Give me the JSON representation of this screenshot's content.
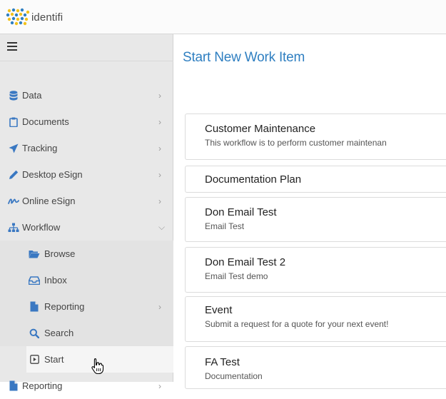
{
  "app": {
    "logo_text": "identifi"
  },
  "colors": {
    "accent": "#2f7fc1",
    "sidebar_bg": "#e8e8e8",
    "icon": "#3a78c2"
  },
  "sidebar": {
    "menu_icon": "hamburger-icon",
    "items": [
      {
        "label": "Data",
        "icon": "database-icon",
        "chevron": ">"
      },
      {
        "label": "Documents",
        "icon": "clipboard-icon",
        "chevron": ">"
      },
      {
        "label": "Tracking",
        "icon": "send-icon",
        "chevron": ">"
      },
      {
        "label": "Desktop eSign",
        "icon": "pen-icon",
        "chevron": ">"
      },
      {
        "label": "Online eSign",
        "icon": "signature-icon",
        "chevron": ">"
      },
      {
        "label": "Workflow",
        "icon": "sitemap-icon",
        "chevron": "v"
      },
      {
        "label": "Browse",
        "icon": "folder-open-icon"
      },
      {
        "label": "Inbox",
        "icon": "inbox-icon"
      },
      {
        "label": "Reporting",
        "icon": "file-icon",
        "chevron": ">"
      },
      {
        "label": "Search",
        "icon": "search-icon"
      },
      {
        "label": "Start",
        "icon": "play-square-icon"
      },
      {
        "label": "Reporting",
        "icon": "file-icon",
        "chevron": ">"
      }
    ]
  },
  "main": {
    "title": "Start New Work Item",
    "work_items": [
      {
        "title": "Customer Maintenance",
        "description": "This workflow is to perform customer maintenan"
      },
      {
        "title": "Documentation Plan",
        "description": ""
      },
      {
        "title": "Don Email Test",
        "description": "Email Test"
      },
      {
        "title": "Don Email Test 2",
        "description": "Email Test demo"
      },
      {
        "title": "Event",
        "description": "Submit a request for a quote for your next event!"
      },
      {
        "title": "FA Test",
        "description": "Documentation"
      }
    ]
  }
}
